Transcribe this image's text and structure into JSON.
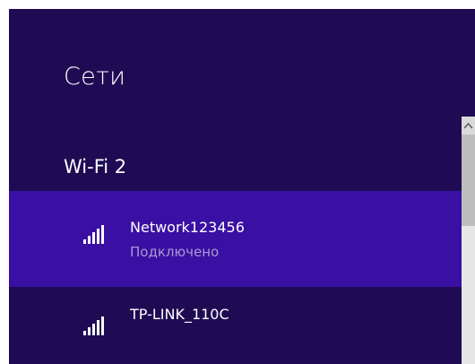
{
  "panel": {
    "title": "Сети",
    "background_color": "#1e0b54",
    "highlight_color": "#3a0fa3"
  },
  "adapter": {
    "name": "Wi-Fi 2"
  },
  "networks": [
    {
      "name": "Network123456",
      "status": "Подключено",
      "icon": "wifi-signal-icon",
      "selected": true
    },
    {
      "name": "TP-LINK_110C",
      "icon": "wifi-signal-icon",
      "selected": false
    }
  ],
  "scrollbar": {
    "up_icon": "chevron-up-icon"
  }
}
